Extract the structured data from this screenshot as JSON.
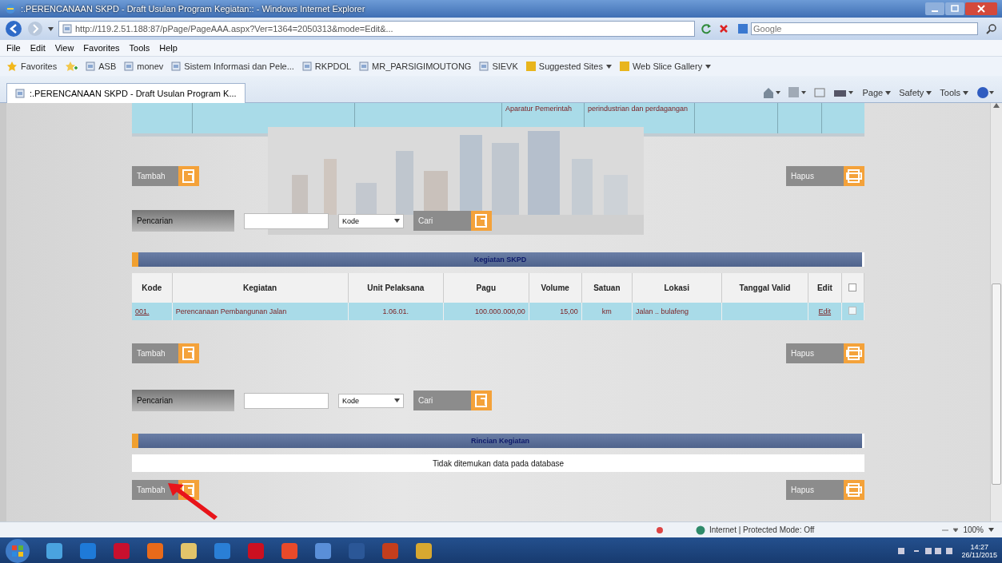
{
  "window": {
    "title": ":.PERENCANAAN SKPD - Draft Usulan Program Kegiatan:: - Windows Internet Explorer"
  },
  "address_bar": {
    "url": "http://119.2.51.188:87/pPage/PageAAA.aspx?Ver=1364=2050313&mode=Edit&...",
    "search_placeholder": "Google"
  },
  "menu": [
    "File",
    "Edit",
    "View",
    "Favorites",
    "Tools",
    "Help"
  ],
  "favorites": {
    "label": "Favorites",
    "items": [
      {
        "label": "ASB",
        "kind": "link"
      },
      {
        "label": "monev",
        "kind": "link"
      },
      {
        "label": "Sistem Informasi dan Pele...",
        "kind": "link"
      },
      {
        "label": "RKPDOL",
        "kind": "link"
      },
      {
        "label": "MR_PARSIGIMOUTONG",
        "kind": "link"
      },
      {
        "label": "SIEVK",
        "kind": "link"
      },
      {
        "label": "Suggested Sites",
        "kind": "menu"
      },
      {
        "label": "Web Slice Gallery",
        "kind": "menu"
      }
    ]
  },
  "tabs": [
    {
      "label": ":.PERENCANAAN SKPD - Draft Usulan Program K...",
      "selected": true
    }
  ],
  "command_bar": [
    "Page",
    "Safety",
    "Tools"
  ],
  "top_row": {
    "cells": [
      "",
      "",
      "",
      "Aparatur Pemerintah",
      "perindustrian dan perdagangan",
      "",
      "",
      ""
    ]
  },
  "blocks": [
    {
      "kind": "actions",
      "add": "Tambah",
      "delete": "Hapus"
    },
    {
      "kind": "search",
      "label": "Pencarian",
      "filter": "Kode",
      "button": "Cari"
    },
    {
      "kind": "table",
      "title": "Kegiatan SKPD",
      "columns": [
        "Kode",
        "Kegiatan",
        "Unit Pelaksana",
        "Pagu",
        "Volume",
        "Satuan",
        "Lokasi",
        "Tanggal Valid",
        "Edit"
      ],
      "select_all_checked": false,
      "rows": [
        {
          "cells": [
            "001.",
            "Perencanaan Pembangunan Jalan",
            "1.06.01.",
            "100.000.000,00",
            "15,00",
            "km",
            "Jalan .. bulafeng",
            ""
          ],
          "edit": "Edit",
          "checked": false
        }
      ]
    },
    {
      "kind": "actions",
      "add": "Tambah",
      "delete": "Hapus"
    },
    {
      "kind": "search",
      "label": "Pencarian",
      "filter": "Kode",
      "button": "Cari"
    },
    {
      "kind": "panel",
      "title": "Rincian Kegiatan",
      "message": "Tidak ditemukan data pada database"
    },
    {
      "kind": "actions",
      "add": "Tambah",
      "delete": "Hapus"
    }
  ],
  "status_bar": {
    "zone": "Internet | Protected Mode: Off",
    "zoom": "100%"
  },
  "taskbar": {
    "time": "14:27",
    "date": "26/11/2015"
  }
}
